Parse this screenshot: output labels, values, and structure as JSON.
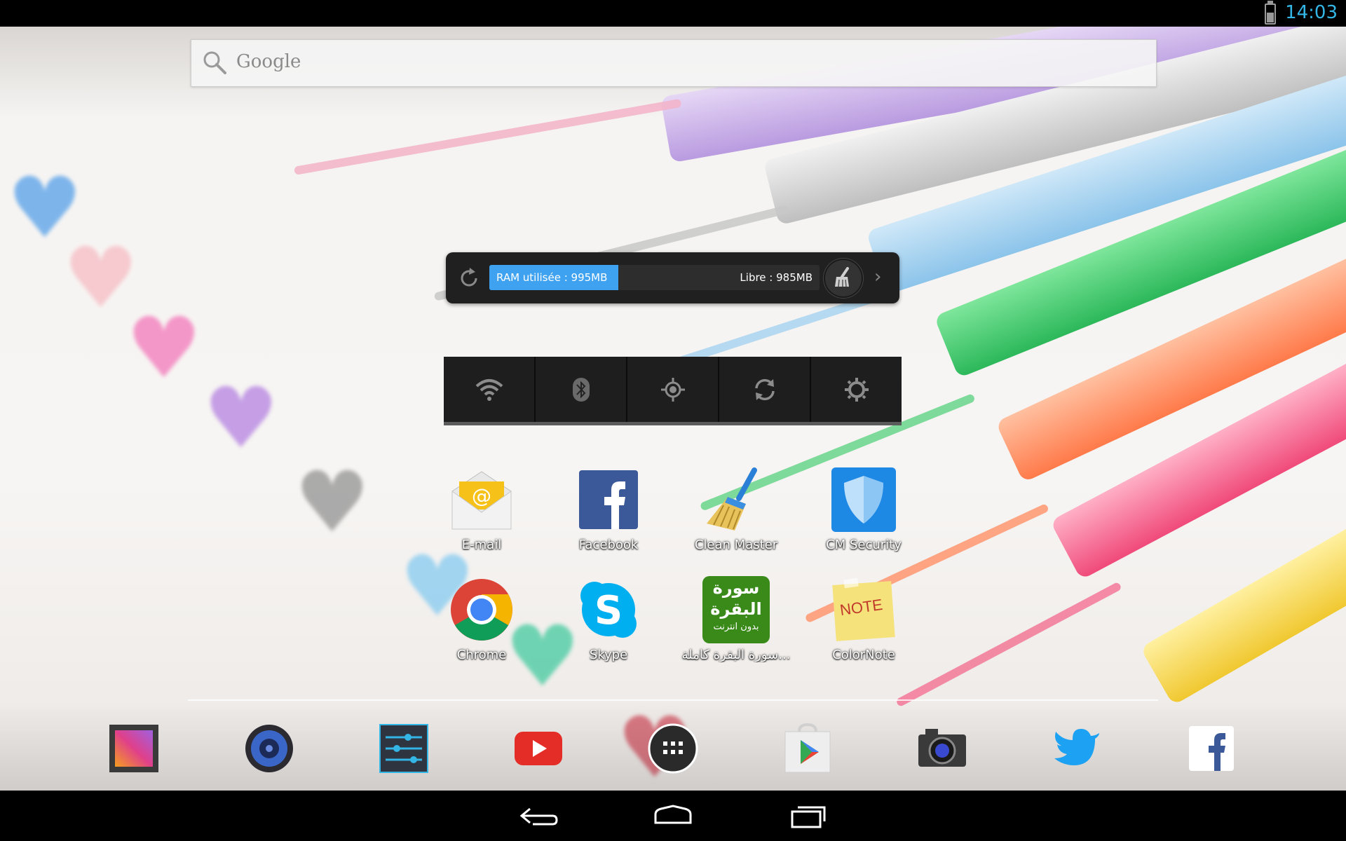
{
  "status_bar": {
    "time": "14:03",
    "battery_icon": "battery-icon",
    "time_color": "#33b5e5"
  },
  "search": {
    "label": "Google",
    "icon": "search-icon"
  },
  "ram_widget": {
    "used_label": "RAM utilisée : 995MB",
    "free_label": "Libre : 985MB",
    "used_fraction": 0.39,
    "accent": "#3ea2f0",
    "icons": [
      "refresh-icon",
      "broom-icon",
      "chevron-right-icon"
    ]
  },
  "power_widget": {
    "buttons": [
      "wifi-icon",
      "bluetooth-icon",
      "gps-icon",
      "sync-icon",
      "brightness-icon"
    ]
  },
  "apps": [
    {
      "label": "E-mail",
      "icon": "email-icon"
    },
    {
      "label": "Facebook",
      "icon": "facebook-icon"
    },
    {
      "label": "Clean Master",
      "icon": "broom-icon"
    },
    {
      "label": "CM Security",
      "icon": "shield-icon"
    },
    {
      "label": "Chrome",
      "icon": "chrome-icon"
    },
    {
      "label": "Skype",
      "icon": "skype-icon"
    },
    {
      "label": "سورة البقرة كاملة...",
      "icon": "quran-app-icon",
      "icon_text_top": "سورة",
      "icon_text_mid": "البقرة",
      "icon_text_bottom": "بدون انترنت"
    },
    {
      "label": "ColorNote",
      "icon": "note-icon",
      "icon_text": "NOTE"
    }
  ],
  "dock": [
    {
      "icon": "gallery-icon"
    },
    {
      "icon": "music-icon"
    },
    {
      "icon": "settings-sliders-icon"
    },
    {
      "icon": "youtube-icon"
    },
    {
      "icon": "app-drawer-icon"
    },
    {
      "icon": "play-store-icon"
    },
    {
      "icon": "camera-icon"
    },
    {
      "icon": "twitter-icon"
    },
    {
      "icon": "facebook-icon"
    }
  ],
  "nav_bar": {
    "buttons": [
      "back-icon",
      "home-icon",
      "recent-apps-icon"
    ]
  }
}
